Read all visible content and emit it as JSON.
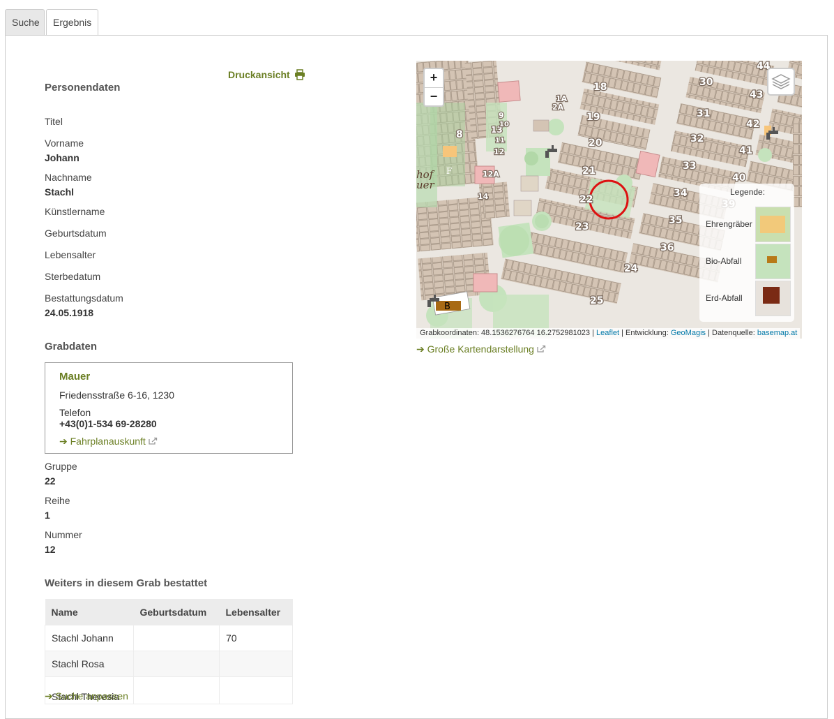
{
  "tabs": {
    "suche": "Suche",
    "ergebnis": "Ergebnis"
  },
  "print": {
    "label": "Druckansicht"
  },
  "person": {
    "heading": "Personendaten",
    "titel_label": "Titel",
    "vorname_label": "Vorname",
    "vorname": "Johann",
    "nachname_label": "Nachname",
    "nachname": "Stachl",
    "kuenstler_label": "Künstlername",
    "geburt_label": "Geburtsdatum",
    "alter_label": "Lebensalter",
    "sterbe_label": "Sterbedatum",
    "bestattung_label": "Bestattungsdatum",
    "bestattung": "24.05.1918"
  },
  "grab": {
    "heading": "Grabdaten",
    "friedhof": {
      "name": "Mauer",
      "address": "Friedensstraße 6-16, 1230",
      "phone_label": "Telefon",
      "phone": "+43(0)1-534 69-28280",
      "fahrplan": "Fahrplanauskunft"
    },
    "gruppe_label": "Gruppe",
    "gruppe": "22",
    "reihe_label": "Reihe",
    "reihe": "1",
    "nummer_label": "Nummer",
    "nummer": "12"
  },
  "weitere": {
    "heading": "Weiters in diesem Grab bestattet",
    "columns": [
      "Name",
      "Geburtsdatum",
      "Lebensalter"
    ],
    "rows": [
      [
        "Stachl Johann",
        "",
        "70"
      ],
      [
        "Stachl Rosa",
        "",
        ""
      ],
      [
        "Stachl Theresia",
        "",
        ""
      ]
    ]
  },
  "suche_link": "Suche anpassen",
  "map": {
    "zoom_in": "+",
    "zoom_out": "−",
    "legend_title": "Legende:",
    "legend_items": [
      "Ehrengräber",
      "Bio-Abfall",
      "Erd-Abfall"
    ],
    "labels": {
      "g18": "18",
      "g19": "19",
      "g20": "20",
      "g21": "21",
      "g22": "22",
      "g23": "23",
      "g24": "24",
      "g25": "25",
      "g30": "30",
      "g31": "31",
      "g32": "32",
      "g33": "33",
      "g34": "34",
      "g35": "35",
      "g36": "36",
      "g39": "39",
      "g40": "40",
      "g41": "41",
      "g42": "42",
      "g43": "43",
      "g44": "44",
      "g8": "8",
      "g9": "9",
      "g10": "10",
      "g11": "11",
      "g12": "12",
      "g13": "13",
      "g14": "14",
      "g1a": "1A",
      "g2a": "2A",
      "g12a": "12A",
      "gf": "F",
      "gb": "B",
      "hof": "hof",
      "uer": "uer"
    },
    "attribution": {
      "coords": "Grabkoordinaten: 48.1536276764 16.2752981023",
      "leaflet": "Leaflet",
      "entwicklung": "Entwicklung:",
      "geomagis": "GeoMagis",
      "datenquelle": "Datenquelle:",
      "basemap": "basemap.at"
    },
    "big_map_link": "Große Kartendarstellung"
  }
}
